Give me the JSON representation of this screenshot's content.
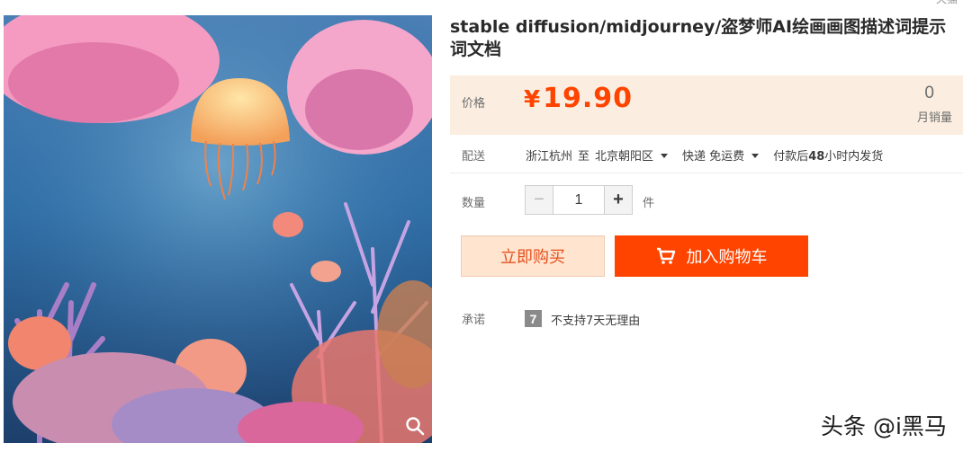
{
  "product": {
    "title": "stable diffusion/midjourney/盗梦师AI绘画画图描述词提示词文档",
    "image_alt": "underwater jellyfish coral scene"
  },
  "price": {
    "label": "价格",
    "currency": "¥",
    "value": "19.90",
    "sales_count": "0",
    "sales_label": "月销量"
  },
  "delivery": {
    "label": "配送",
    "from": "浙江杭州",
    "to_word": "至",
    "to": "北京朝阳区",
    "method": "快递 免运费",
    "ship_prefix": "付款后",
    "ship_hours": "48",
    "ship_suffix": "小时内发货"
  },
  "quantity": {
    "label": "数量",
    "minus": "−",
    "value": "1",
    "plus": "+",
    "unit": "件"
  },
  "actions": {
    "buy_now": "立即购买",
    "add_to_cart": "加入购物车"
  },
  "promise": {
    "label": "承诺",
    "badge": "7",
    "text": "不支持7天无理由"
  },
  "watermark": "头条 @i黑马",
  "colors": {
    "accent": "#ff4400",
    "price_bg": "#fbeee1",
    "buy_now_bg": "#ffe4d0"
  }
}
